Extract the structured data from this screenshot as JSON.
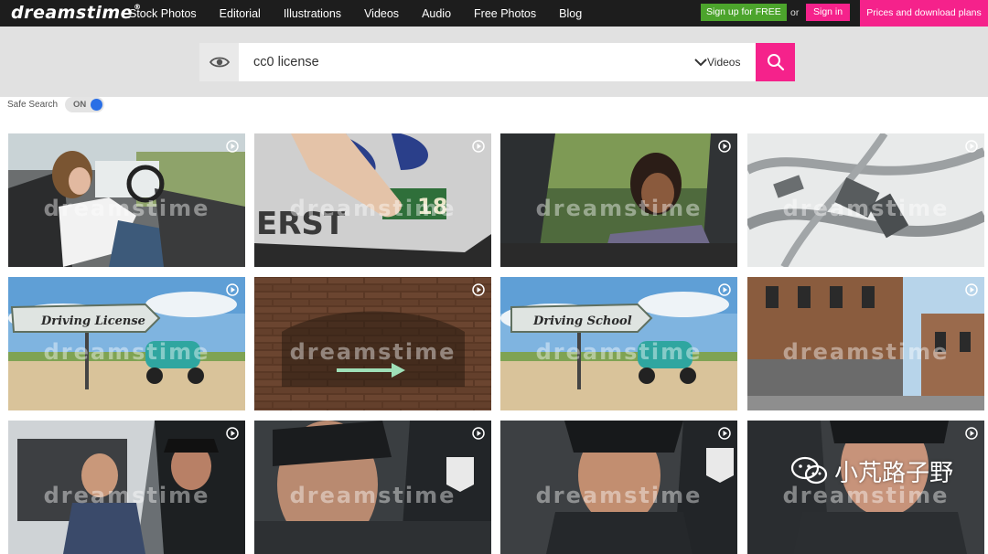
{
  "header": {
    "logo": "dreamstime",
    "nav": [
      "Stock Photos",
      "Editorial",
      "Illustrations",
      "Videos",
      "Audio",
      "Free Photos",
      "Blog"
    ],
    "signup_label": "Sign up for FREE",
    "or_label": "or",
    "signin_label": "Sign in",
    "prices_label": "Prices and download plans"
  },
  "search": {
    "query": "cc0 license",
    "type_label": "Videos"
  },
  "safe_search": {
    "label": "Safe Search",
    "state": "ON"
  },
  "results": {
    "watermark": "dreamstime",
    "tiles": [
      {
        "subject": "woman-driving-car"
      },
      {
        "subject": "license-plate-sticker"
      },
      {
        "subject": "woman-in-car"
      },
      {
        "subject": "aerial-snow-parking-lot"
      },
      {
        "subject": "driving-license-sign-scooter",
        "sign_text": "Driving License"
      },
      {
        "subject": "brick-wall-arrow-sign"
      },
      {
        "subject": "driving-school-sign-scooter",
        "sign_text": "Driving School"
      },
      {
        "subject": "brick-building-street"
      },
      {
        "subject": "police-officer-driver"
      },
      {
        "subject": "police-officer-closeup"
      },
      {
        "subject": "police-officer-closeup"
      },
      {
        "subject": "police-officer-closeup"
      }
    ]
  },
  "overlay": {
    "text": "小芃路子野"
  },
  "colors": {
    "brand_pink": "#f5228b",
    "signup_green": "#4ca42c",
    "topbar": "#1d1d1d",
    "toggle_blue": "#2a6fe6"
  }
}
